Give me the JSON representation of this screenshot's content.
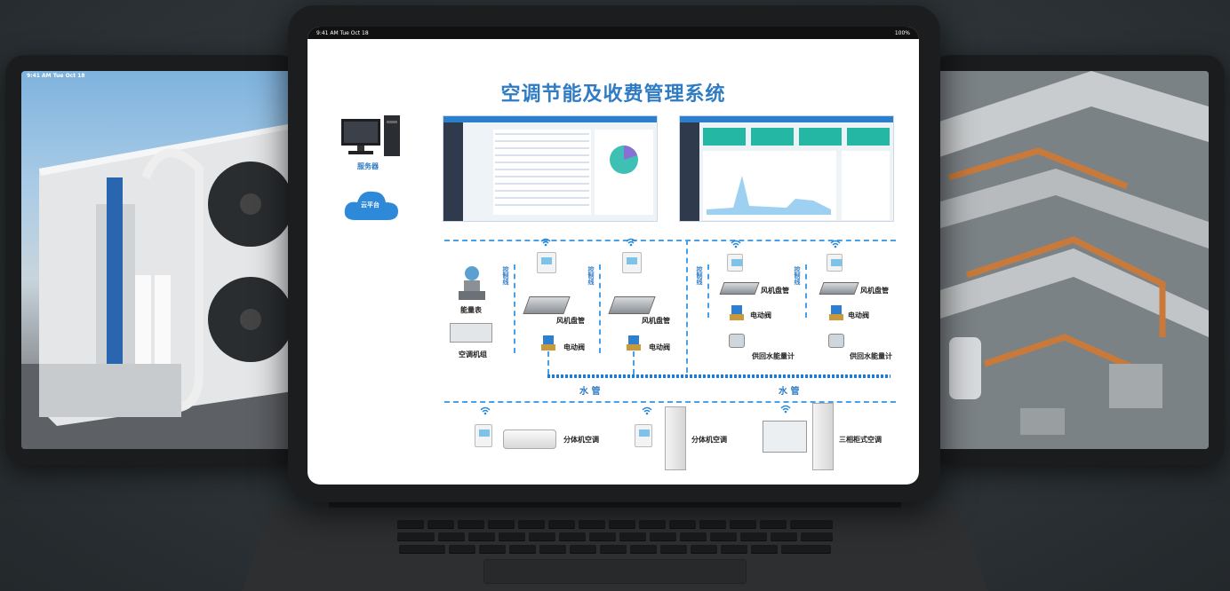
{
  "left_tablet": {
    "status": "9:41 AM   Tue Oct 18"
  },
  "main_tablet": {
    "status_time": "9:41 AM   Tue Oct 18",
    "status_battery": "100%",
    "title": "空调节能及收费管理系统",
    "server_label": "服务器",
    "cloud_label": "云平台",
    "energy_meter_label": "能量表",
    "ac_unit_label": "空调机组",
    "control_line_label": "控制线",
    "fan_coil_label": "风机盘管",
    "electric_valve_label": "电动阀",
    "supply_return_meter_label": "供回水能量计",
    "water_pipe_label": "水 管",
    "split_ac_label": "分体机空调",
    "three_phase_ac_label": "三相柜式空调"
  },
  "colors": {
    "accent": "#2f7bc4",
    "pipe": "#1c7cd6",
    "dash": "#4aa0e6"
  }
}
